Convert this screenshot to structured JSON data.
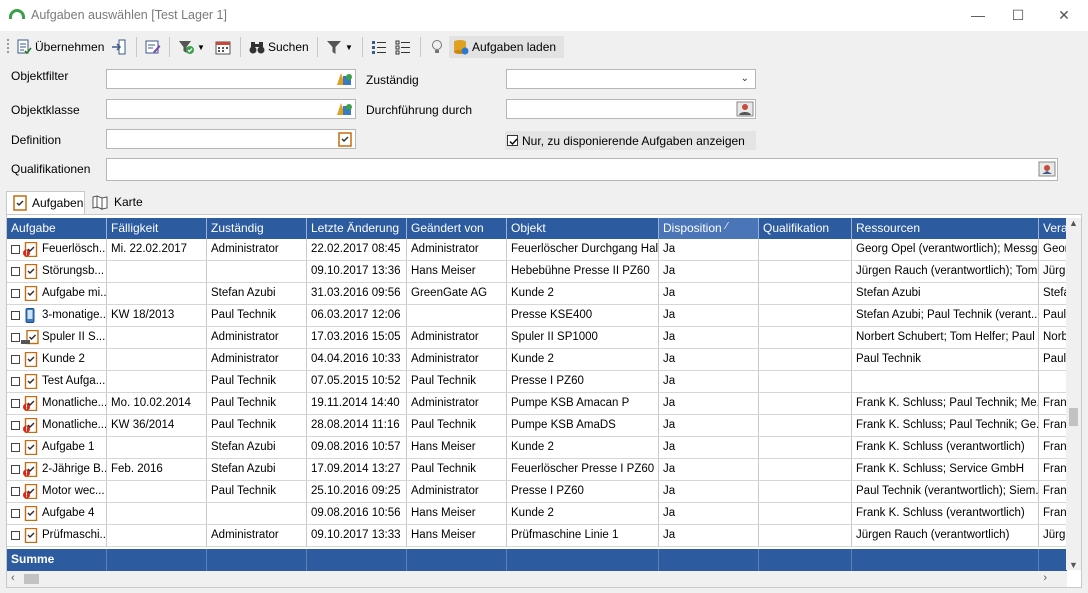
{
  "window": {
    "title": "Aufgaben auswählen [Test Lager 1]",
    "min_glyph": "—",
    "max_glyph": "☐",
    "close_glyph": "✕"
  },
  "toolbar": {
    "uebernehmen_label": "Übernehmen",
    "suchen_label": "Suchen",
    "aufgaben_laden_label": "Aufgaben laden"
  },
  "form": {
    "objektfilter_label": "Objektfilter",
    "objektklasse_label": "Objektklasse",
    "definition_label": "Definition",
    "qualifikationen_label": "Qualifikationen",
    "zustaendig_label": "Zuständig",
    "durchfuehrung_label": "Durchführung durch",
    "nur_disponierende_label": "Nur, zu disponierende Aufgaben anzeigen",
    "nur_disponierende_checked": true
  },
  "tabs": {
    "aufgaben": "Aufgaben",
    "karte": "Karte"
  },
  "grid": {
    "columns": [
      "Aufgabe",
      "Fälligkeit",
      "Zuständig",
      "Letzte Änderung",
      "Geändert von",
      "Objekt",
      "Disposition",
      "Qualifikation",
      "Ressourcen",
      "Vera"
    ],
    "rows": [
      {
        "icon": "clip-warn",
        "aufgabe": "Feuerlösch...",
        "faelligkeit": "Mi. 22.02.2017",
        "zustaendig": "Administrator",
        "letzte": "22.02.2017 08:45",
        "geaendert": "Administrator",
        "objekt": "Feuerlöscher Durchgang Hal...",
        "disposition": "Ja",
        "qualifikation": "",
        "ressourcen": "Georg Opel (verantwortlich); Messge...",
        "vera": "Geor"
      },
      {
        "icon": "clip",
        "aufgabe": "Störungsb...",
        "faelligkeit": "",
        "zustaendig": "",
        "letzte": "09.10.2017 13:36",
        "geaendert": "Hans Meiser",
        "objekt": "Hebebühne Presse II PZ60",
        "disposition": "Ja",
        "qualifikation": "",
        "ressourcen": "Jürgen Rauch (verantwortlich); Tom ...",
        "vera": "Jürge"
      },
      {
        "icon": "clip",
        "aufgabe": "Aufgabe mi...",
        "faelligkeit": "",
        "zustaendig": "Stefan Azubi",
        "letzte": "31.03.2016 09:56",
        "geaendert": "GreenGate AG",
        "objekt": "Kunde 2",
        "disposition": "Ja",
        "qualifikation": "",
        "ressourcen": "Stefan Azubi",
        "vera": "Stefa"
      },
      {
        "icon": "phone",
        "aufgabe": "3-monatige...",
        "faelligkeit": "KW 18/2013",
        "zustaendig": "Paul Technik",
        "letzte": "06.03.2017 12:06",
        "geaendert": "",
        "objekt": "Presse KSE400",
        "disposition": "Ja",
        "qualifikation": "",
        "ressourcen": "Stefan Azubi; Paul Technik (verant...",
        "vera": "Paul"
      },
      {
        "icon": "laptop",
        "aufgabe": "Spuler II S...",
        "faelligkeit": "",
        "zustaendig": "Administrator",
        "letzte": "17.03.2016 15:05",
        "geaendert": "Administrator",
        "objekt": "Spuler II SP1000",
        "disposition": "Ja",
        "qualifikation": "",
        "ressourcen": "Norbert Schubert; Tom Helfer; Paul ...",
        "vera": "Norb"
      },
      {
        "icon": "clip",
        "aufgabe": "Kunde 2",
        "faelligkeit": "",
        "zustaendig": "Administrator",
        "letzte": "04.04.2016 10:33",
        "geaendert": "Administrator",
        "objekt": "Kunde 2",
        "disposition": "Ja",
        "qualifikation": "",
        "ressourcen": "Paul Technik",
        "vera": "Paul"
      },
      {
        "icon": "clip",
        "aufgabe": "Test Aufga...",
        "faelligkeit": "",
        "zustaendig": "Paul Technik",
        "letzte": "07.05.2015 10:52",
        "geaendert": "Paul Technik",
        "objekt": "Presse I PZ60",
        "disposition": "Ja",
        "qualifikation": "",
        "ressourcen": "",
        "vera": ""
      },
      {
        "icon": "clip-warn",
        "aufgabe": "Monatliche...",
        "faelligkeit": "Mo. 10.02.2014",
        "zustaendig": "Paul Technik",
        "letzte": "19.11.2014 14:40",
        "geaendert": "Administrator",
        "objekt": "Pumpe KSB Amacan P",
        "disposition": "Ja",
        "qualifikation": "",
        "ressourcen": "Frank K. Schluss; Paul Technik; Me...",
        "vera": "Fran"
      },
      {
        "icon": "clip-warn",
        "aufgabe": "Monatliche...",
        "faelligkeit": "KW 36/2014",
        "zustaendig": "Paul Technik",
        "letzte": "28.08.2014 11:16",
        "geaendert": "Paul Technik",
        "objekt": "Pumpe KSB AmaDS",
        "disposition": "Ja",
        "qualifikation": "",
        "ressourcen": "Frank K. Schluss; Paul Technik; Ge...",
        "vera": "Fran"
      },
      {
        "icon": "clip",
        "aufgabe": "Aufgabe 1",
        "faelligkeit": "",
        "zustaendig": "Stefan Azubi",
        "letzte": "09.08.2016 10:57",
        "geaendert": "Hans Meiser",
        "objekt": "Kunde 2",
        "disposition": "Ja",
        "qualifikation": "",
        "ressourcen": "Frank K. Schluss (verantwortlich)",
        "vera": "Fran"
      },
      {
        "icon": "clip-warn",
        "aufgabe": "2-Jährige B...",
        "faelligkeit": "Feb. 2016",
        "zustaendig": "Stefan Azubi",
        "letzte": "17.09.2014 13:27",
        "geaendert": "Paul Technik",
        "objekt": "Feuerlöscher Presse I PZ60",
        "disposition": "Ja",
        "qualifikation": "",
        "ressourcen": "Frank K. Schluss; Service GmbH",
        "vera": "Fran"
      },
      {
        "icon": "clip-warn",
        "aufgabe": "Motor wec...",
        "faelligkeit": "",
        "zustaendig": "Paul Technik",
        "letzte": "25.10.2016 09:25",
        "geaendert": "Administrator",
        "objekt": "Presse I PZ60",
        "disposition": "Ja",
        "qualifikation": "",
        "ressourcen": "Paul Technik (verantwortlich); Siem...",
        "vera": "Fran"
      },
      {
        "icon": "clip",
        "aufgabe": "Aufgabe 4",
        "faelligkeit": "",
        "zustaendig": "",
        "letzte": "09.08.2016 10:56",
        "geaendert": "Hans Meiser",
        "objekt": "Kunde 2",
        "disposition": "Ja",
        "qualifikation": "",
        "ressourcen": "Frank K. Schluss (verantwortlich)",
        "vera": "Fran"
      },
      {
        "icon": "clip",
        "aufgabe": "Prüfmaschi...",
        "faelligkeit": "",
        "zustaendig": "Administrator",
        "letzte": "09.10.2017 13:33",
        "geaendert": "Hans Meiser",
        "objekt": "Prüfmaschine Linie 1",
        "disposition": "Ja",
        "qualifikation": "",
        "ressourcen": "Jürgen Rauch (verantwortlich)",
        "vera": "Jürge"
      }
    ],
    "summe_label": "Summe"
  },
  "colors": {
    "header_bg": "#2d5ba0",
    "accent_green": "#3aa04a"
  }
}
